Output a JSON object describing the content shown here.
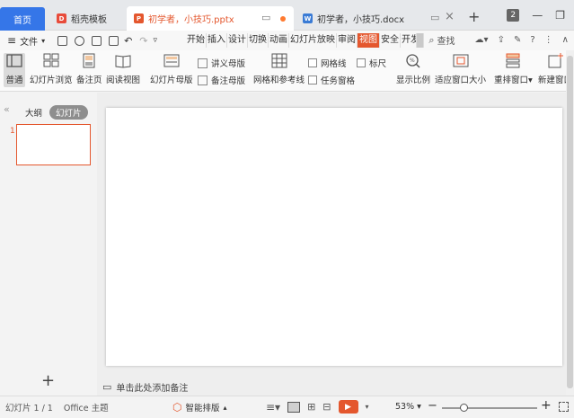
{
  "tabs": {
    "home": "首页",
    "template": "稻壳模板",
    "pptx": "初学者，小技巧.pptx",
    "docx": "初学者，小技巧.docx",
    "badge": "2"
  },
  "menu": {
    "file": "文件",
    "ribbon_tabs": [
      "开始",
      "插入",
      "设计",
      "切换",
      "动画",
      "幻灯片放映",
      "审阅",
      "视图",
      "安全",
      "开发"
    ],
    "active_tab": "视图",
    "search": "查找"
  },
  "ribbon": {
    "normal": "普通",
    "slide_browse": "幻灯片浏览",
    "notes_page": "备注页",
    "reading_view": "阅读视图",
    "slide_master": "幻灯片母版",
    "handout_master": "讲义母版",
    "notes_master": "备注母版",
    "grid_guides": "网格和参考线",
    "gridlines": "网格线",
    "ruler": "标尺",
    "task_pane": "任务窗格",
    "zoom_ratio": "显示比例",
    "fit_window": "适应窗口大小",
    "arrange": "重排窗口",
    "new_window": "新建窗口"
  },
  "left": {
    "outline": "大纲",
    "slides": "幻灯片",
    "thumb_number": "1"
  },
  "notes": {
    "placeholder": "单击此处添加备注"
  },
  "status": {
    "slide_info": "幻灯片 1 / 1",
    "theme": "Office 主题",
    "smart_layout": "智能排版",
    "zoom": "53%"
  },
  "colors": {
    "accent": "#e4572e",
    "home_tab": "#3576e8"
  }
}
